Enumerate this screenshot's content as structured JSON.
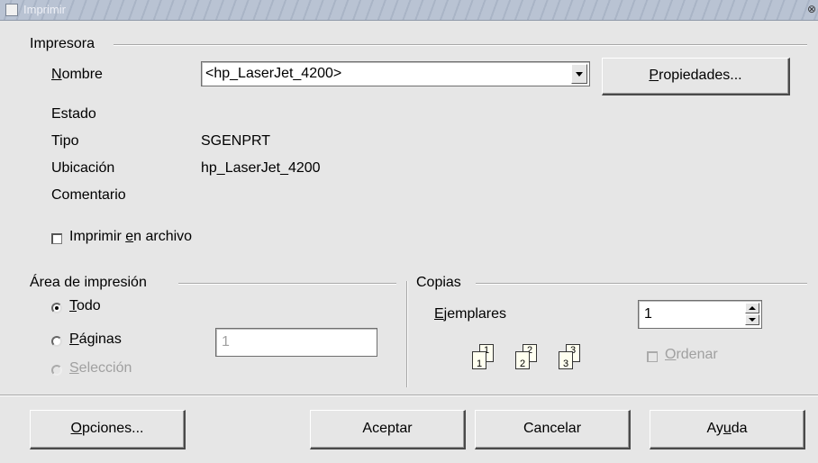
{
  "window": {
    "title": "Imprimir"
  },
  "printer": {
    "group_label": "Impresora",
    "name_label_pre": "",
    "name_label_u": "N",
    "name_label_post": "ombre",
    "name_value": "<hp_LaserJet_4200>",
    "properties_button_u": "P",
    "properties_button_rest": "ropiedades...",
    "status_label": "Estado",
    "status_value": "",
    "type_label": "Tipo",
    "type_value": "SGENPRT",
    "location_label": "Ubicación",
    "location_value": "hp_LaserJet_4200",
    "comment_label": "Comentario",
    "comment_value": "",
    "print_to_file_pre": "Imprimir ",
    "print_to_file_u": "e",
    "print_to_file_post": "n archivo",
    "print_to_file_checked": false
  },
  "print_area": {
    "group_label": "Área de impresión",
    "all_u": "T",
    "all_rest": "odo",
    "all_selected": true,
    "pages_u": "P",
    "pages_rest": "áginas",
    "pages_value": "1",
    "selection_u": "S",
    "selection_rest": "elección",
    "selection_enabled": false
  },
  "copies": {
    "group_label": "Copias",
    "copies_label_u": "E",
    "copies_label_rest": "jemplares",
    "copies_value": "1",
    "collate_u": "O",
    "collate_rest": "rdenar",
    "collate_enabled": false,
    "collate_icon_numbers": [
      "1",
      "1",
      "2",
      "2",
      "3",
      "3"
    ]
  },
  "buttons": {
    "options_u": "O",
    "options_rest": "pciones...",
    "ok": "Aceptar",
    "cancel": "Cancelar",
    "help_pre": "Ay",
    "help_u": "u",
    "help_post": "da"
  }
}
